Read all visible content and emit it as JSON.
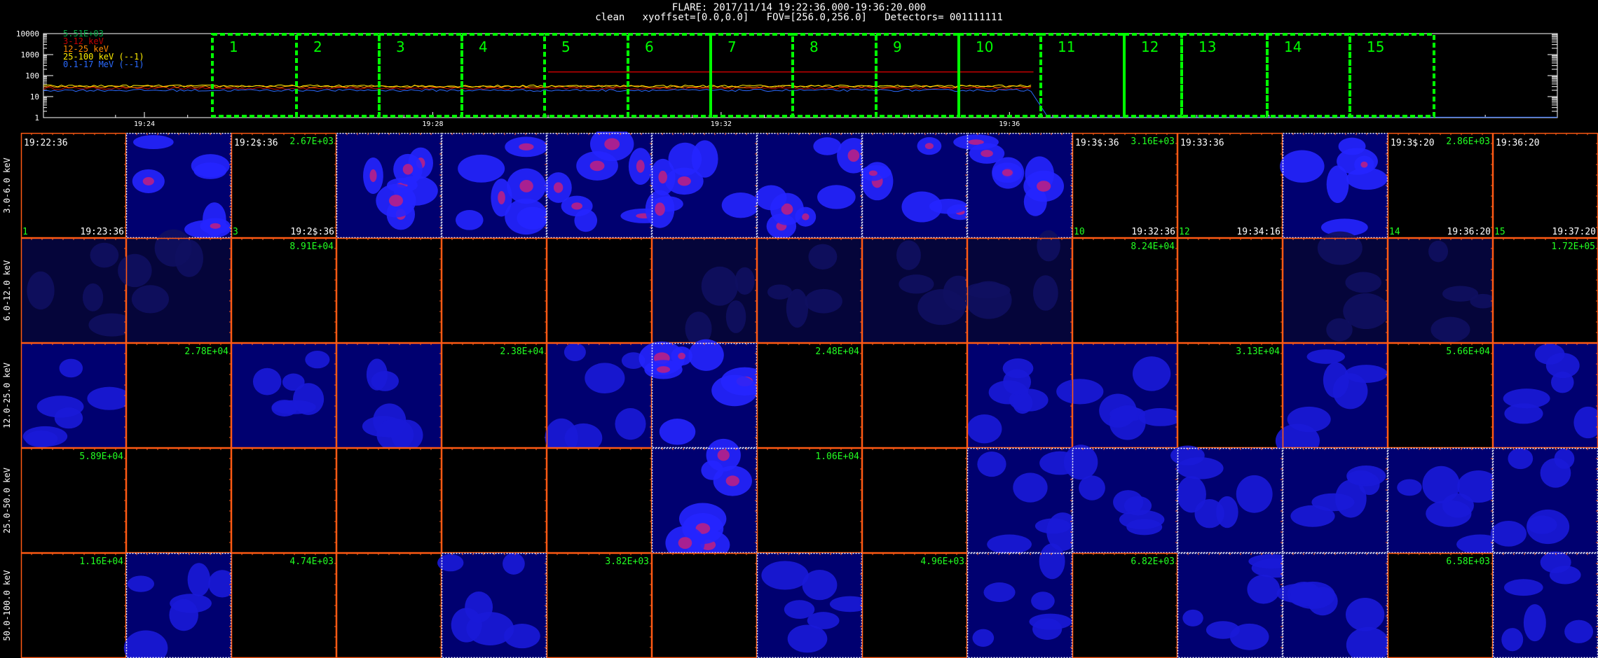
{
  "header": {
    "title": "FLARE: 2017/11/14 19:22:36.000-19:36:20.000",
    "subtitle": "clean   xyoffset=[0.0,0.0]   FOV=[256.0,256.0]   Detectors= 001111111"
  },
  "colors": {
    "background": "#000000",
    "frame": "#ff5a14",
    "highlight_frame": "#ffffff",
    "interval_box": "#00ff00",
    "map_dark": "#000080",
    "map_bright": "#2020ff",
    "map_peak": "#c02080"
  },
  "lightcurve": {
    "y_ticks": [
      "10000",
      "1000",
      "100",
      "10",
      "1"
    ],
    "x_ticks": [
      "19:24",
      "19:28",
      "19:32",
      "19:36"
    ],
    "legend": [
      {
        "label": "5.51E+03",
        "color": "#00aa44"
      },
      {
        "label": "3-12 keV",
        "color": "#c00000"
      },
      {
        "label": "12-25 keV",
        "color": "#ff8800"
      },
      {
        "label": "25-100 keV (--1)",
        "color": "#ffee00"
      },
      {
        "label": "0.1-17 MeV (--1)",
        "color": "#2a6aff"
      }
    ],
    "intervals": [
      "1",
      "2",
      "3",
      "4",
      "5",
      "6",
      "7",
      "8",
      "9",
      "10",
      "11",
      "12",
      "13",
      "14",
      "15"
    ]
  },
  "chart_data": {
    "type": "heatmap",
    "title": "FLARE: 2017/11/14 19:22:36.000-19:36:20.000",
    "lightcurve": {
      "type": "line",
      "ylog": true,
      "ylim": [
        1,
        10000
      ],
      "xlim": [
        "19:22:36",
        "19:36:20"
      ],
      "series": [
        {
          "name": "3-12 keV",
          "approx_level": 25
        },
        {
          "name": "12-25 keV",
          "approx_level": 30
        },
        {
          "name": "25-100 keV (--1)",
          "approx_level": 32
        },
        {
          "name": "0.1-17 MeV (--1)",
          "approx_level": 20
        }
      ],
      "reference_line": 150
    },
    "energy_bands": [
      "3.0-6.0 keV",
      "6.0-12.0 keV",
      "12.0-25.0 keV",
      "25.0-50.0 keV",
      "50.0-100.0 keV"
    ],
    "time_labels": {
      "row0_starts": [
        "19:22:36",
        "",
        "19:2$:36",
        "",
        "",
        "",
        "",
        "",
        "",
        "",
        "19:3$:36",
        "19:33:36",
        "",
        "19:3$:20",
        "19:36:20"
      ],
      "row0_ends": [
        "19:23:36",
        "",
        "19:2$:36",
        "",
        "",
        "",
        "",
        "",
        "",
        "",
        "19:32:36",
        "19:34:16",
        "",
        "19:36:20",
        "19:37:20"
      ],
      "row0_numbers": [
        "1",
        "",
        "3",
        "",
        "",
        "",
        "",
        "",
        "",
        "",
        "10",
        "12",
        "",
        "14",
        "15"
      ]
    },
    "panel_max": [
      [
        "",
        "",
        "2.67E+03",
        "",
        "",
        "",
        "",
        "",
        "",
        "",
        "3.16E+03",
        "",
        "",
        "2.86E+03",
        ""
      ],
      [
        "",
        "",
        "8.91E+04",
        "",
        "",
        "",
        "",
        "",
        "",
        "",
        "8.24E+04",
        "",
        "",
        "",
        "1.72E+05"
      ],
      [
        "",
        "2.78E+04",
        "",
        "",
        "2.38E+04",
        "",
        "",
        "2.48E+04",
        "",
        "",
        "",
        "3.13E+04",
        "",
        "5.66E+04",
        ""
      ],
      [
        "5.89E+04",
        "",
        "",
        "",
        "",
        "",
        "",
        "1.06E+04",
        "",
        "",
        "",
        "",
        "",
        "",
        ""
      ],
      [
        "1.16E+04",
        "",
        "4.74E+03",
        "",
        "",
        "3.82E+03",
        "",
        "",
        "4.96E+03",
        "",
        "6.82E+03",
        "",
        "",
        "6.58E+03",
        ""
      ]
    ],
    "panel_intensity": [
      [
        0,
        3,
        0,
        3,
        3,
        3,
        3,
        3,
        3,
        3,
        0,
        0,
        3,
        0,
        0
      ],
      [
        1,
        1,
        0,
        0,
        0,
        0,
        1,
        1,
        1,
        1,
        0,
        0,
        1,
        1,
        0
      ],
      [
        2,
        0,
        2,
        2,
        0,
        2,
        3,
        0,
        0,
        2,
        2,
        0,
        2,
        0,
        2
      ],
      [
        0,
        0,
        0,
        0,
        0,
        0,
        3,
        0,
        0,
        2,
        2,
        2,
        2,
        2,
        2
      ],
      [
        0,
        2,
        0,
        0,
        2,
        0,
        0,
        2,
        0,
        2,
        0,
        2,
        2,
        0,
        2
      ]
    ]
  }
}
